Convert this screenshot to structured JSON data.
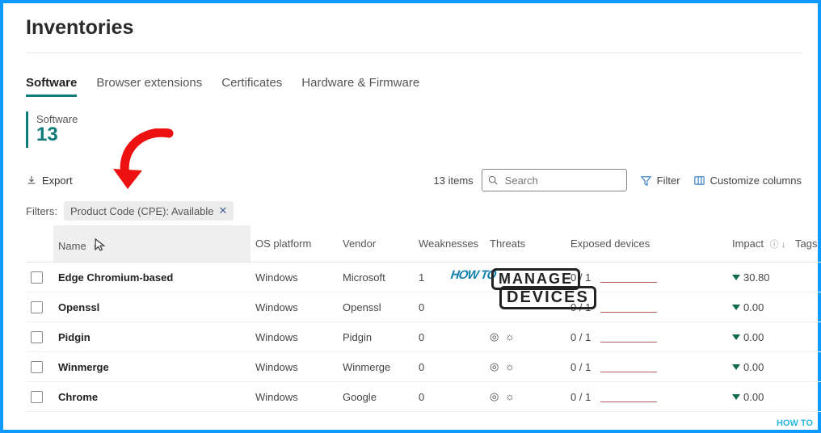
{
  "page_title": "Inventories",
  "tabs": [
    {
      "label": "Software",
      "active": true
    },
    {
      "label": "Browser extensions",
      "active": false
    },
    {
      "label": "Certificates",
      "active": false
    },
    {
      "label": "Hardware & Firmware",
      "active": false
    }
  ],
  "stat": {
    "label": "Software",
    "value": "13"
  },
  "toolbar": {
    "export_label": "Export",
    "items_count": "13 items",
    "search_placeholder": "Search",
    "filter_label": "Filter",
    "customize_label": "Customize columns"
  },
  "filters": {
    "label": "Filters:",
    "chip_text": "Product Code (CPE): Available",
    "chip_close": "✕"
  },
  "columns": {
    "name": "Name",
    "os": "OS platform",
    "vendor": "Vendor",
    "weak": "Weaknesses",
    "threats": "Threats",
    "exposed": "Exposed devices",
    "impact": "Impact",
    "tags": "Tags"
  },
  "rows": [
    {
      "name": "Edge Chromium-based",
      "os": "Windows",
      "vendor": "Microsoft",
      "weaknesses": "1",
      "threats": "",
      "exposed": "0 / 1",
      "impact": "30.80"
    },
    {
      "name": "Openssl",
      "os": "Windows",
      "vendor": "Openssl",
      "weaknesses": "0",
      "threats": "",
      "exposed": "0 / 1",
      "impact": "0.00"
    },
    {
      "name": "Pidgin",
      "os": "Windows",
      "vendor": "Pidgin",
      "weaknesses": "0",
      "threats": "◎ ☼",
      "exposed": "0 / 1",
      "impact": "0.00"
    },
    {
      "name": "Winmerge",
      "os": "Windows",
      "vendor": "Winmerge",
      "weaknesses": "0",
      "threats": "◎ ☼",
      "exposed": "0 / 1",
      "impact": "0.00"
    },
    {
      "name": "Chrome",
      "os": "Windows",
      "vendor": "Google",
      "weaknesses": "0",
      "threats": "◎ ☼",
      "exposed": "0 / 1",
      "impact": "0.00"
    }
  ],
  "watermark": {
    "line1": "MANAGE",
    "line2": "DEVICES",
    "howto": "HOW\nTO",
    "corner": "HOW TO"
  }
}
